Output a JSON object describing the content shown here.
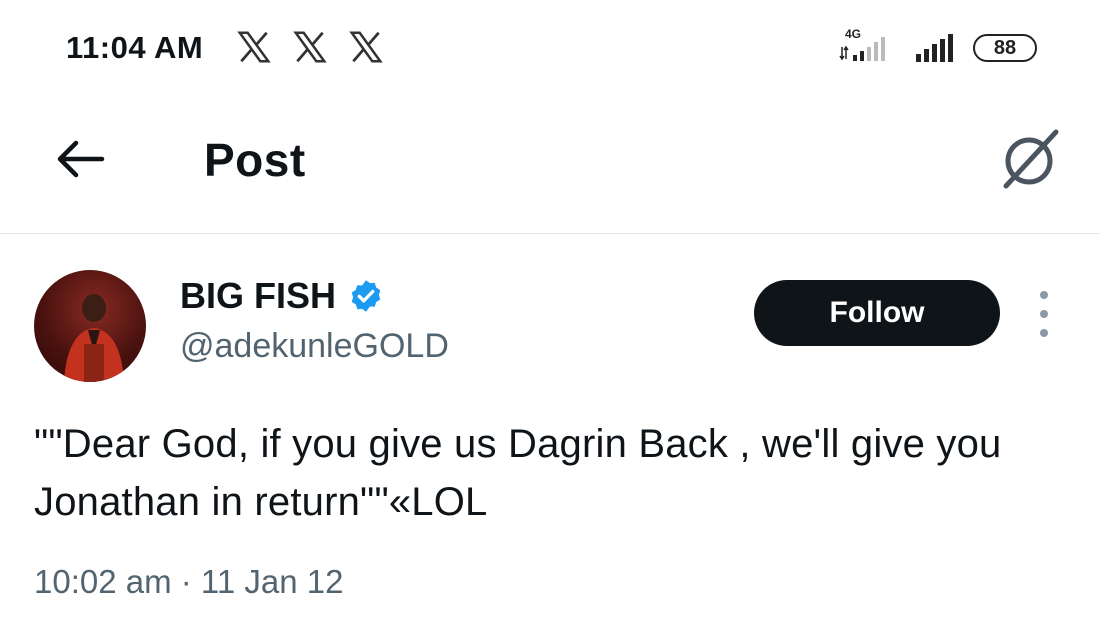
{
  "status_bar": {
    "time": "11:04 AM",
    "notification_icons": [
      "x-logo-icon",
      "x-logo-icon",
      "x-logo-icon"
    ],
    "network_label": "4G",
    "battery": "88"
  },
  "header": {
    "title": "Post",
    "back_icon": "back-arrow-icon",
    "grok_icon": "grok-icon"
  },
  "post": {
    "display_name": "BIG FISH",
    "verified": true,
    "handle": "@adekunleGOLD",
    "follow_label": "Follow",
    "text": "\"\"Dear God, if you give us Dagrin Back , we'll give you Jonathan in return\"\"«LOL",
    "timestamp": "10:02 am · 11 Jan 12"
  },
  "colors": {
    "text_primary": "#0f1419",
    "text_secondary": "#536471",
    "verified_blue": "#1d9bf0",
    "follow_bg": "#0f1419"
  }
}
